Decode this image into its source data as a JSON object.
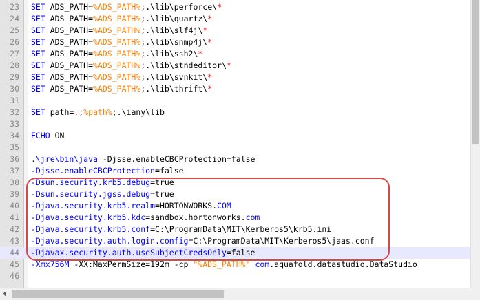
{
  "editor": {
    "lines": [
      {
        "num": "23",
        "tokens": [
          {
            "c": "kw",
            "t": "SET"
          },
          {
            "c": "txt",
            "t": " ADS_PATH="
          },
          {
            "c": "var",
            "t": "%ADS_PATH%"
          },
          {
            "c": "txt",
            "t": ";.\\lib\\perforce\\"
          },
          {
            "c": "op",
            "t": "*"
          }
        ]
      },
      {
        "num": "24",
        "tokens": [
          {
            "c": "kw",
            "t": "SET"
          },
          {
            "c": "txt",
            "t": " ADS_PATH="
          },
          {
            "c": "var",
            "t": "%ADS_PATH%"
          },
          {
            "c": "txt",
            "t": ";.\\lib\\quartz\\"
          },
          {
            "c": "op",
            "t": "*"
          }
        ]
      },
      {
        "num": "25",
        "tokens": [
          {
            "c": "kw",
            "t": "SET"
          },
          {
            "c": "txt",
            "t": " ADS_PATH="
          },
          {
            "c": "var",
            "t": "%ADS_PATH%"
          },
          {
            "c": "txt",
            "t": ";.\\lib\\slf4j\\"
          },
          {
            "c": "op",
            "t": "*"
          }
        ]
      },
      {
        "num": "26",
        "tokens": [
          {
            "c": "kw",
            "t": "SET"
          },
          {
            "c": "txt",
            "t": " ADS_PATH="
          },
          {
            "c": "var",
            "t": "%ADS_PATH%"
          },
          {
            "c": "txt",
            "t": ";.\\lib\\snmp4j\\"
          },
          {
            "c": "op",
            "t": "*"
          }
        ]
      },
      {
        "num": "27",
        "tokens": [
          {
            "c": "kw",
            "t": "SET"
          },
          {
            "c": "txt",
            "t": " ADS_PATH="
          },
          {
            "c": "var",
            "t": "%ADS_PATH%"
          },
          {
            "c": "txt",
            "t": ";.\\lib\\ssh2\\"
          },
          {
            "c": "op",
            "t": "*"
          }
        ]
      },
      {
        "num": "28",
        "tokens": [
          {
            "c": "kw",
            "t": "SET"
          },
          {
            "c": "txt",
            "t": " ADS_PATH="
          },
          {
            "c": "var",
            "t": "%ADS_PATH%"
          },
          {
            "c": "txt",
            "t": ";.\\lib\\stndeditor\\"
          },
          {
            "c": "op",
            "t": "*"
          }
        ]
      },
      {
        "num": "29",
        "tokens": [
          {
            "c": "kw",
            "t": "SET"
          },
          {
            "c": "txt",
            "t": " ADS_PATH="
          },
          {
            "c": "var",
            "t": "%ADS_PATH%"
          },
          {
            "c": "txt",
            "t": ";.\\lib\\svnkit\\"
          },
          {
            "c": "op",
            "t": "*"
          }
        ]
      },
      {
        "num": "30",
        "tokens": [
          {
            "c": "kw",
            "t": "SET"
          },
          {
            "c": "txt",
            "t": " ADS_PATH="
          },
          {
            "c": "var",
            "t": "%ADS_PATH%"
          },
          {
            "c": "txt",
            "t": ";.\\lib\\thrift\\"
          },
          {
            "c": "op",
            "t": "*"
          }
        ]
      },
      {
        "num": "31",
        "tokens": []
      },
      {
        "num": "32",
        "tokens": [
          {
            "c": "kw",
            "t": "SET"
          },
          {
            "c": "txt",
            "t": " path="
          },
          {
            "c": "op",
            "t": "."
          },
          {
            "c": "txt",
            "t": ";"
          },
          {
            "c": "var",
            "t": "%path%"
          },
          {
            "c": "txt",
            "t": ";.\\iany\\lib"
          }
        ]
      },
      {
        "num": "33",
        "tokens": []
      },
      {
        "num": "34",
        "tokens": [
          {
            "c": "kw",
            "t": "ECHO"
          },
          {
            "c": "txt",
            "t": " ON"
          }
        ]
      },
      {
        "num": "35",
        "tokens": []
      },
      {
        "num": "36",
        "tokens": [
          {
            "c": "tok",
            "t": ".\\jre\\bin\\java"
          },
          {
            "c": "txt",
            "t": " -Djsse.enableCBCProtection=false"
          }
        ]
      },
      {
        "num": "37",
        "tokens": [
          {
            "c": "tok",
            "t": "-Djsse.enableCBCProtection"
          },
          {
            "c": "txt",
            "t": "=false"
          }
        ]
      },
      {
        "num": "38",
        "tokens": [
          {
            "c": "tok",
            "t": "-Dsun.security.krb5.debug"
          },
          {
            "c": "txt",
            "t": "=true"
          }
        ]
      },
      {
        "num": "39",
        "tokens": [
          {
            "c": "tok",
            "t": "-Dsun.security.jgss.debug"
          },
          {
            "c": "txt",
            "t": "=true"
          }
        ]
      },
      {
        "num": "40",
        "tokens": [
          {
            "c": "tok",
            "t": "-Djava.security.krb5.realm"
          },
          {
            "c": "txt",
            "t": "=HORTONWORKS."
          },
          {
            "c": "tok",
            "t": "COM"
          }
        ]
      },
      {
        "num": "41",
        "tokens": [
          {
            "c": "tok",
            "t": "-Djava.security.krb5.kdc"
          },
          {
            "c": "txt",
            "t": "=sandbox.hortonworks."
          },
          {
            "c": "tok",
            "t": "com"
          }
        ]
      },
      {
        "num": "42",
        "tokens": [
          {
            "c": "tok",
            "t": "-Djava.security.krb5.conf"
          },
          {
            "c": "txt",
            "t": "=C:\\ProgramData\\MIT\\Kerberos5\\krb5.ini"
          }
        ]
      },
      {
        "num": "43",
        "tokens": [
          {
            "c": "tok",
            "t": "-Djava.security.auth.login.config"
          },
          {
            "c": "txt",
            "t": "=C:\\ProgramData\\MIT\\Kerberos5\\jaas.conf"
          }
        ]
      },
      {
        "num": "44",
        "tokens": [
          {
            "c": "tok",
            "t": "-Djavax.security.auth.useSubjectCredsOnly"
          },
          {
            "c": "txt",
            "t": "=false"
          }
        ],
        "highlight": true
      },
      {
        "num": "45",
        "tokens": [
          {
            "c": "tok",
            "t": "-Xmx756M"
          },
          {
            "c": "txt",
            "t": " -XX:MaxPermSize=192m -cp "
          },
          {
            "c": "var",
            "t": "\"%ADS_PATH%\""
          },
          {
            "c": "txt",
            "t": " "
          },
          {
            "c": "tok",
            "t": "com"
          },
          {
            "c": "txt",
            "t": ".aquafold.datastudio.DataStudio"
          }
        ]
      },
      {
        "num": "46",
        "tokens": []
      }
    ]
  },
  "colors": {
    "keyword": "#0000ff",
    "variable": "#ff8000",
    "operator": "#ff0000",
    "callout": "#d94848",
    "current_line": "#e8e8ff"
  }
}
